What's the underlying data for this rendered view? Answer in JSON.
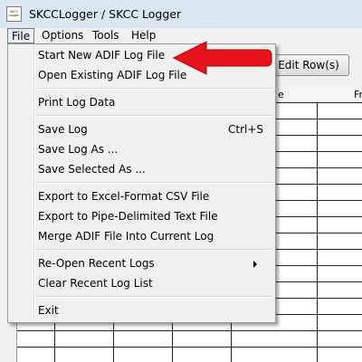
{
  "window": {
    "title": "SKCCLogger / SKCC Logger",
    "icon_text": "SKCC Logger",
    "icon": "app-logo-icon"
  },
  "menubar": {
    "items": [
      "File",
      "Options",
      "Tools",
      "Help"
    ]
  },
  "toolbar": {
    "edit_rows_label": "Edit Row(s)"
  },
  "grid": {
    "header_partial_e": "e",
    "header_partial_fr": "Fr"
  },
  "file_menu": {
    "start_new": "Start New ADIF Log File",
    "open_existing": "Open Existing ADIF Log File",
    "print_log": "Print Log Data",
    "save_log": "Save Log",
    "save_log_shortcut": "Ctrl+S",
    "save_log_as": "Save Log As ...",
    "save_selected_as": "Save Selected As ...",
    "export_csv": "Export to Excel-Format CSV File",
    "export_pipe": "Export to Pipe-Delimited Text File",
    "merge_adif": "Merge ADIF File Into Current Log",
    "reopen_recent": "Re-Open Recent Logs",
    "clear_recent": "Clear Recent Log List",
    "exit": "Exit"
  },
  "annotation": {
    "arrow_color": "#e8141b",
    "icon": "red-arrow-icon"
  }
}
